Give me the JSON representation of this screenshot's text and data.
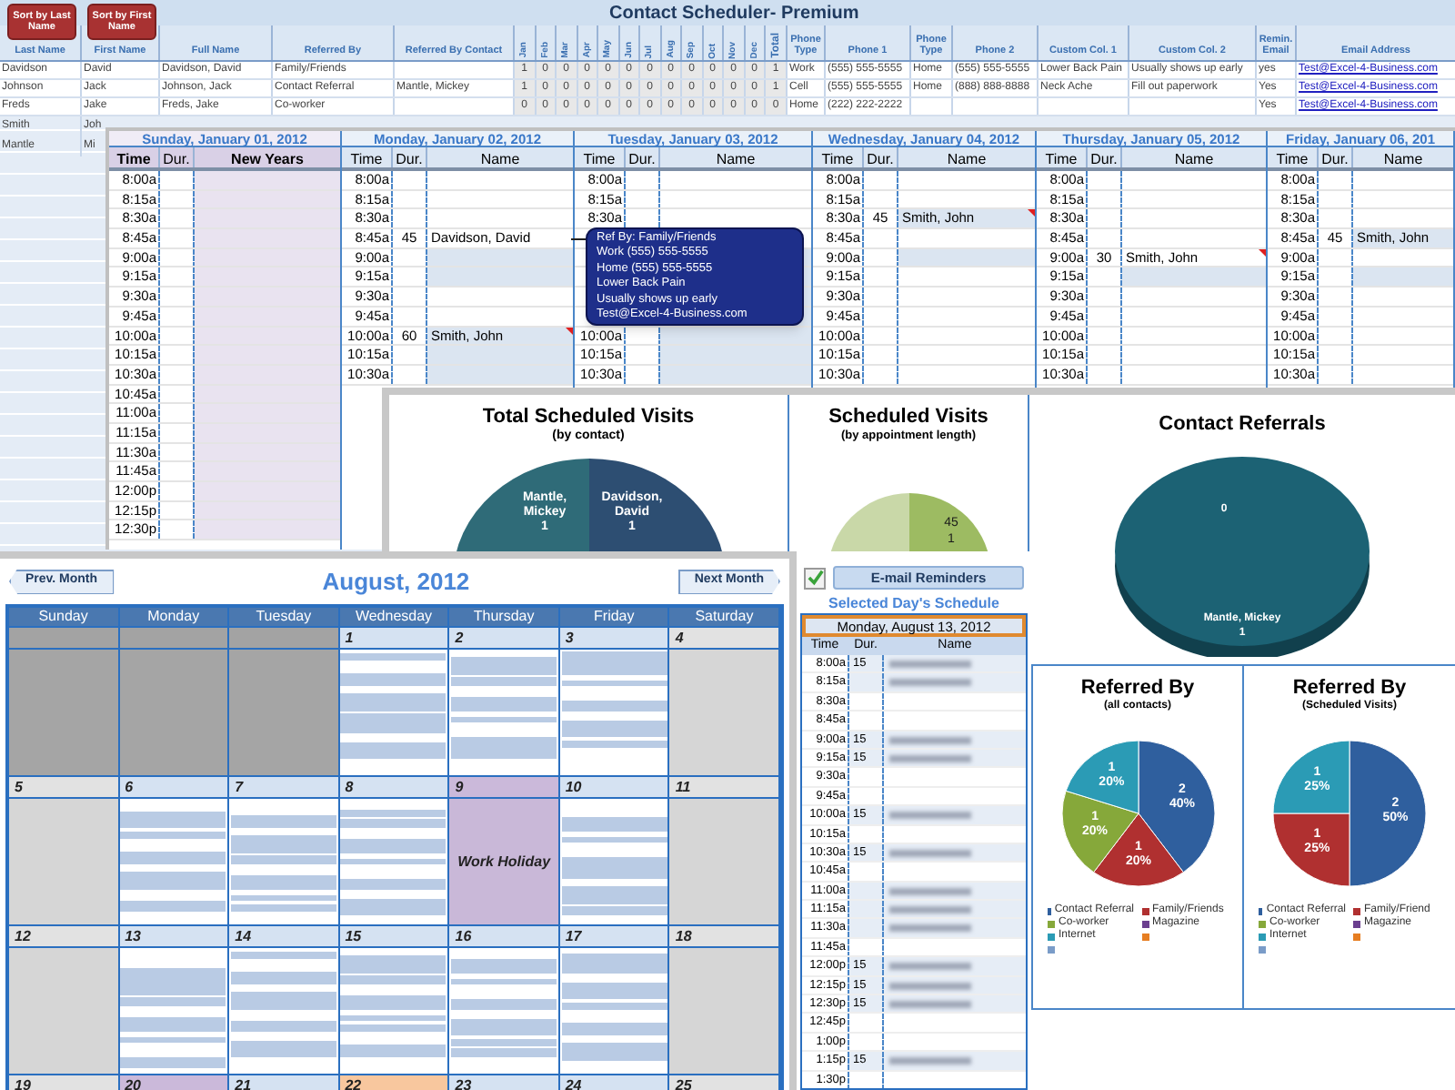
{
  "contacts": {
    "sort_buttons": [
      "Sort by Last Name",
      "Sort by First Name"
    ],
    "title": "Contact Scheduler- Premium",
    "columns": [
      {
        "label": "Last Name",
        "kind": "text"
      },
      {
        "label": "First Name",
        "kind": "text"
      },
      {
        "label": "Full Name",
        "kind": "text"
      },
      {
        "label": "Referred By",
        "kind": "text"
      },
      {
        "label": "Referred By Contact",
        "kind": "text"
      },
      {
        "label": "Jan",
        "kind": "vertical"
      },
      {
        "label": "Feb",
        "kind": "vertical"
      },
      {
        "label": "Mar",
        "kind": "vertical"
      },
      {
        "label": "Apr",
        "kind": "vertical"
      },
      {
        "label": "May",
        "kind": "vertical"
      },
      {
        "label": "Jun",
        "kind": "vertical"
      },
      {
        "label": "Jul",
        "kind": "vertical"
      },
      {
        "label": "Aug",
        "kind": "vertical"
      },
      {
        "label": "Sep",
        "kind": "vertical"
      },
      {
        "label": "Oct",
        "kind": "vertical"
      },
      {
        "label": "Nov",
        "kind": "vertical"
      },
      {
        "label": "Dec",
        "kind": "vertical"
      },
      {
        "label": "Total",
        "kind": "total"
      },
      {
        "label": "Phone Type",
        "kind": "text"
      },
      {
        "label": "Phone 1",
        "kind": "text"
      },
      {
        "label": "Phone Type",
        "kind": "text"
      },
      {
        "label": "Phone 2",
        "kind": "text"
      },
      {
        "label": "Custom Col. 1",
        "kind": "text"
      },
      {
        "label": "Custom Col. 2",
        "kind": "text"
      },
      {
        "label": "Remin. Email",
        "kind": "text"
      },
      {
        "label": "Email Address",
        "kind": "email"
      }
    ],
    "rows": [
      {
        "cells": [
          "Davidson",
          "David",
          "Davidson, David",
          "Family/Friends",
          null,
          "1",
          "0",
          "0",
          "0",
          "0",
          "0",
          "0",
          "0",
          "0",
          "0",
          "0",
          "0",
          "1",
          "Work",
          "(555) 555-5555",
          "Home",
          "(555) 555-5555",
          "Lower Back Pain",
          "Usually shows up early",
          "yes",
          "Test@Excel-4-Business.com"
        ]
      },
      {
        "cells": [
          "Johnson",
          "Jack",
          "Johnson, Jack",
          "Contact Referral",
          "Mantle, Mickey",
          "1",
          "0",
          "0",
          "0",
          "0",
          "0",
          "0",
          "0",
          "0",
          "0",
          "0",
          "0",
          "1",
          "Cell",
          "(555) 555-5555",
          "Home",
          "(888) 888-8888",
          "Neck Ache",
          "Fill out paperwork",
          "Yes",
          "Test@Excel-4-Business.com"
        ]
      },
      {
        "cells": [
          "Freds",
          "Jake",
          "Freds, Jake",
          "Co-worker",
          null,
          "0",
          "0",
          "0",
          "0",
          "0",
          "0",
          "0",
          "0",
          "0",
          "0",
          "0",
          "0",
          "0",
          "Home",
          "(222) 222-2222",
          null,
          null,
          null,
          null,
          "Yes",
          "Test@Excel-4-Business.com"
        ]
      }
    ],
    "more_rows": [
      {
        "last": "Smith",
        "first": "Joh"
      },
      {
        "last": "Mantle",
        "first": "Mi"
      }
    ]
  },
  "week": {
    "days": [
      {
        "header": "Sunday, January 01, 2012",
        "columns": [
          "Time",
          "Dur.",
          "New Years"
        ],
        "holiday": true,
        "rows": [
          {
            "time": "8:00a",
            "booked": false,
            "note": false
          },
          {
            "time": "8:15a",
            "booked": false,
            "note": false
          },
          {
            "time": "8:30a",
            "booked": false,
            "note": false
          },
          {
            "time": "8:45a",
            "booked": false,
            "note": false
          },
          {
            "time": "9:00a",
            "booked": false,
            "note": false
          },
          {
            "time": "9:15a",
            "booked": false,
            "note": false
          },
          {
            "time": "9:30a",
            "booked": false,
            "note": false
          },
          {
            "time": "9:45a",
            "booked": false,
            "note": false
          },
          {
            "time": "10:00a",
            "booked": false,
            "note": false
          },
          {
            "time": "10:15a",
            "booked": false,
            "note": false
          },
          {
            "time": "10:30a",
            "booked": false,
            "note": false
          },
          {
            "time": "10:45a",
            "booked": false,
            "note": false
          },
          {
            "time": "11:00a",
            "booked": false,
            "note": false
          },
          {
            "time": "11:15a",
            "booked": false,
            "note": false
          },
          {
            "time": "11:30a",
            "booked": false,
            "note": false
          },
          {
            "time": "11:45a",
            "booked": false,
            "note": false
          },
          {
            "time": "12:00p",
            "booked": false,
            "note": false
          },
          {
            "time": "12:15p",
            "booked": false,
            "note": false
          },
          {
            "time": "12:30p",
            "booked": false,
            "note": false
          }
        ]
      },
      {
        "header": "Monday, January 02, 2012",
        "columns": [
          "Time",
          "Dur.",
          "Name"
        ],
        "holiday": false,
        "rows": [
          {
            "time": "8:00a",
            "booked": false,
            "note": false
          },
          {
            "time": "8:15a",
            "booked": false,
            "note": false
          },
          {
            "time": "8:30a",
            "booked": false,
            "note": false
          },
          {
            "time": "8:45a",
            "dur": "45",
            "name": "Davidson, David",
            "booked": false,
            "note": false
          },
          {
            "time": "9:00a",
            "booked": true,
            "note": false
          },
          {
            "time": "9:15a",
            "booked": true,
            "note": false
          },
          {
            "time": "9:30a",
            "booked": false,
            "note": false
          },
          {
            "time": "9:45a",
            "booked": false,
            "note": false
          },
          {
            "time": "10:00a",
            "dur": "60",
            "name": "Smith, John",
            "booked": true,
            "note": true
          },
          {
            "time": "10:15a",
            "booked": true,
            "note": false
          },
          {
            "time": "10:30a",
            "booked": true,
            "note": false
          }
        ]
      },
      {
        "header": "Tuesday, January 03, 2012",
        "columns": [
          "Time",
          "Dur.",
          "Name"
        ],
        "holiday": false,
        "rows": [
          {
            "time": "8:00a",
            "booked": false,
            "note": false
          },
          {
            "time": "8:15a",
            "booked": false,
            "note": false
          },
          {
            "time": "8:30a",
            "booked": false,
            "note": false
          },
          {
            "booked": false,
            "note": false
          },
          {
            "booked": true,
            "note": false
          },
          {
            "booked": true,
            "note": false
          },
          {
            "booked": true,
            "note": false
          },
          {
            "booked": true,
            "note": false
          },
          {
            "time": "10:00a",
            "booked": true,
            "note": false
          },
          {
            "time": "10:15a",
            "booked": true,
            "note": false
          },
          {
            "time": "10:30a",
            "booked": true,
            "note": false
          }
        ]
      },
      {
        "header": "Wednesday, January 04, 2012",
        "columns": [
          "Time",
          "Dur.",
          "Name"
        ],
        "holiday": false,
        "rows": [
          {
            "time": "8:00a",
            "booked": false,
            "note": false
          },
          {
            "time": "8:15a",
            "booked": false,
            "note": false
          },
          {
            "time": "8:30a",
            "dur": "45",
            "name": "Smith, John",
            "booked": true,
            "note": true
          },
          {
            "time": "8:45a",
            "booked": false,
            "note": false
          },
          {
            "time": "9:00a",
            "booked": true,
            "note": false
          },
          {
            "time": "9:15a",
            "booked": false,
            "note": false
          },
          {
            "time": "9:30a",
            "booked": false,
            "note": false
          },
          {
            "time": "9:45a",
            "booked": false,
            "note": false
          },
          {
            "time": "10:00a",
            "booked": false,
            "note": false
          },
          {
            "time": "10:15a",
            "booked": false,
            "note": false
          },
          {
            "time": "10:30a",
            "booked": false,
            "note": false
          }
        ]
      },
      {
        "header": "Thursday, January 05, 2012",
        "columns": [
          "Time",
          "Dur.",
          "Name"
        ],
        "holiday": false,
        "rows": [
          {
            "time": "8:00a",
            "booked": false,
            "note": false
          },
          {
            "time": "8:15a",
            "booked": false,
            "note": false
          },
          {
            "time": "8:30a",
            "booked": false,
            "note": false
          },
          {
            "time": "8:45a",
            "booked": false,
            "note": false
          },
          {
            "time": "9:00a",
            "dur": "30",
            "name": "Smith, John",
            "booked": false,
            "note": true
          },
          {
            "time": "9:15a",
            "booked": true,
            "note": false
          },
          {
            "time": "9:30a",
            "booked": false,
            "note": false
          },
          {
            "time": "9:45a",
            "booked": false,
            "note": false
          },
          {
            "time": "10:00a",
            "booked": false,
            "note": false
          },
          {
            "time": "10:15a",
            "booked": false,
            "note": false
          },
          {
            "time": "10:30a",
            "booked": false,
            "note": false
          }
        ]
      },
      {
        "header": "Friday, January 06, 201",
        "columns": [
          "Time",
          "Dur.",
          "Name"
        ],
        "holiday": false,
        "rows": [
          {
            "time": "8:00a",
            "booked": false,
            "note": false
          },
          {
            "time": "8:15a",
            "booked": false,
            "note": false
          },
          {
            "time": "8:30a",
            "booked": false,
            "note": false
          },
          {
            "time": "8:45a",
            "dur": "45",
            "name": "Smith, John",
            "booked": true,
            "note": false
          },
          {
            "time": "9:00a",
            "booked": false,
            "note": false
          },
          {
            "time": "9:15a",
            "booked": true,
            "note": false
          },
          {
            "time": "9:30a",
            "booked": false,
            "note": false
          },
          {
            "time": "9:45a",
            "booked": false,
            "note": false
          },
          {
            "time": "10:00a",
            "booked": false,
            "note": false
          },
          {
            "time": "10:15a",
            "booked": false,
            "note": false
          },
          {
            "time": "10:30a",
            "booked": false,
            "note": false
          }
        ]
      }
    ]
  },
  "tooltip": {
    "lines": [
      "Ref By: Family/Friends",
      "Work (555) 555-5555",
      "Home (555) 555-5555",
      "Lower Back Pain",
      "Usually shows up early",
      "Test@Excel-4-Business.com"
    ]
  },
  "charts": {
    "total_visits": {
      "title": "Total Scheduled Visits",
      "subtitle": "(by contact)",
      "slices": [
        {
          "label": "Mantle, Mickey",
          "value": "1",
          "color": "#2f6b78"
        },
        {
          "label": "Davidson, David",
          "value": "1",
          "color": "#2d4e72"
        }
      ]
    },
    "visits_by_length": {
      "title": "Scheduled Visits",
      "subtitle": "(by appointment length)",
      "labels": [
        "45",
        "1"
      ]
    },
    "contact_referrals": {
      "title": "Contact Referrals",
      "labels": [
        "0",
        "Mantle, Mickey",
        "1"
      ]
    },
    "referred_all": {
      "title": "Referred By",
      "subtitle": "(all contacts)",
      "chart_data": {
        "type": "pie",
        "categories": [
          "Contact Referral",
          "Family/Friends",
          "Co-worker",
          "Magazine",
          "Internet"
        ],
        "series": [
          {
            "colors": [
              "#2f5f9e",
              "#b03030",
              "#86a83a",
              "#6b3f8f",
              "#2b9bb5"
            ],
            "values": [
              40,
              20,
              20,
              0,
              20
            ]
          }
        ],
        "value_labels": [
          [
            "2",
            "40%"
          ],
          [
            "1",
            "20%"
          ],
          [
            "1",
            "20%"
          ],
          null,
          [
            "1",
            "20%"
          ]
        ]
      },
      "legend_extra": [
        {
          "color": "#e67e22"
        },
        {
          "color": "#7a9cc8"
        }
      ]
    },
    "referred_scheduled": {
      "title": "Referred By",
      "subtitle": "(Scheduled Visits)",
      "chart_data": {
        "type": "pie",
        "categories": [
          "Contact Referral",
          "Family/Friend",
          "Co-worker",
          "Magazine",
          "Internet"
        ],
        "series": [
          {
            "colors": [
              "#2f5f9e",
              "#b03030",
              "#86a83a",
              "#6b3f8f",
              "#2b9bb5"
            ],
            "values": [
              50,
              25,
              0,
              0,
              25
            ]
          }
        ],
        "value_labels": [
          [
            "2",
            "50%"
          ],
          [
            "1",
            "25%"
          ],
          null,
          null,
          [
            "1",
            "25%"
          ]
        ]
      },
      "legend_extra": [
        {
          "color": "#e67e22"
        },
        {
          "color": "#7a9cc8"
        }
      ]
    }
  },
  "calendar": {
    "prev": "Prev. Month",
    "next": "Next Month",
    "title": "August, 2012",
    "weekdays": [
      "Sunday",
      "Monday",
      "Tuesday",
      "Wednesday",
      "Thursday",
      "Friday",
      "Saturday"
    ],
    "weeks": [
      {
        "days": [
          {
            "kind": "outside"
          },
          {
            "kind": "outside"
          },
          {
            "kind": "outside"
          },
          {
            "number": "1",
            "kind": "weekday"
          },
          {
            "number": "2",
            "kind": "weekday"
          },
          {
            "number": "3",
            "kind": "weekday"
          },
          {
            "number": "4",
            "kind": "weekend"
          }
        ]
      },
      {
        "days": [
          {
            "number": "5",
            "kind": "weekend"
          },
          {
            "number": "6",
            "kind": "weekday"
          },
          {
            "number": "7",
            "kind": "weekday"
          },
          {
            "number": "8",
            "kind": "weekday"
          },
          {
            "number": "9",
            "kind": "holiday",
            "label": "Work Holiday"
          },
          {
            "number": "10",
            "kind": "weekday"
          },
          {
            "number": "11",
            "kind": "weekend"
          }
        ]
      },
      {
        "days": [
          {
            "number": "12",
            "kind": "weekend"
          },
          {
            "number": "13",
            "kind": "weekday"
          },
          {
            "number": "14",
            "kind": "weekday"
          },
          {
            "number": "15",
            "kind": "weekday"
          },
          {
            "number": "16",
            "kind": "weekday"
          },
          {
            "number": "17",
            "kind": "weekday"
          },
          {
            "number": "18",
            "kind": "weekend"
          }
        ]
      },
      {
        "days": [
          {
            "number": "19",
            "kind": "weekend"
          },
          {
            "number": "20",
            "kind": "holiday"
          },
          {
            "number": "21",
            "kind": "weekday"
          },
          {
            "number": "22",
            "kind": "today"
          },
          {
            "number": "23",
            "kind": "weekday"
          },
          {
            "number": "24",
            "kind": "weekday"
          },
          {
            "number": "25",
            "kind": "weekend"
          }
        ]
      }
    ]
  },
  "selected_day": {
    "reminders": "E-mail Reminders",
    "reminders_checked": true,
    "heading": "Selected Day's Schedule",
    "date": "Monday, August 13, 2012",
    "columns": [
      "Time",
      "Dur.",
      "Name"
    ],
    "rows": [
      {
        "time": "8:00a",
        "dur": "15",
        "blurred": true
      },
      {
        "time": "8:15a",
        "blurred": true
      },
      {
        "time": "8:30a",
        "blurred": false
      },
      {
        "time": "8:45a",
        "blurred": false
      },
      {
        "time": "9:00a",
        "dur": "15",
        "blurred": true
      },
      {
        "time": "9:15a",
        "dur": "15",
        "blurred": true
      },
      {
        "time": "9:30a",
        "blurred": false
      },
      {
        "time": "9:45a",
        "blurred": false
      },
      {
        "time": "10:00a",
        "dur": "15",
        "blurred": true
      },
      {
        "time": "10:15a",
        "blurred": false
      },
      {
        "time": "10:30a",
        "dur": "15",
        "blurred": true
      },
      {
        "time": "10:45a",
        "blurred": false
      },
      {
        "time": "11:00a",
        "blurred": true
      },
      {
        "time": "11:15a",
        "blurred": true
      },
      {
        "time": "11:30a",
        "blurred": true
      },
      {
        "time": "11:45a",
        "blurred": false
      },
      {
        "time": "12:00p",
        "dur": "15",
        "blurred": true
      },
      {
        "time": "12:15p",
        "dur": "15",
        "blurred": true
      },
      {
        "time": "12:30p",
        "dur": "15",
        "blurred": true
      },
      {
        "time": "12:45p",
        "blurred": false
      },
      {
        "time": "1:00p",
        "blurred": false
      },
      {
        "time": "1:15p",
        "dur": "15",
        "blurred": true
      },
      {
        "time": "1:30p",
        "blurred": false
      }
    ]
  }
}
